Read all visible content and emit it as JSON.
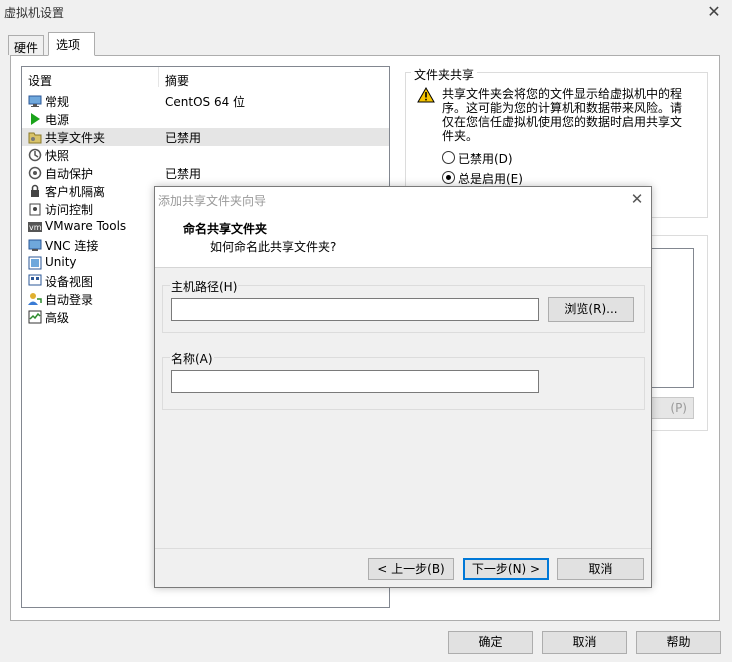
{
  "window": {
    "title": "虚拟机设置"
  },
  "tabs": [
    {
      "label": "硬件"
    },
    {
      "label": "选项"
    }
  ],
  "list": {
    "headers": {
      "setting": "设置",
      "summary": "摘要"
    },
    "rows": [
      {
        "label": "常规",
        "summary": "CentOS 64 位",
        "icon": "monitor-icon",
        "color": "#3a7bd5"
      },
      {
        "label": "电源",
        "summary": "",
        "icon": "play-icon",
        "color": "#1aa31a"
      },
      {
        "label": "共享文件夹",
        "summary": "已禁用",
        "icon": "shared-folder-icon",
        "color": "#8b8b3a"
      },
      {
        "label": "快照",
        "summary": "",
        "icon": "snapshot-icon",
        "color": "#555555"
      },
      {
        "label": "自动保护",
        "summary": "已禁用",
        "icon": "autoprotect-icon",
        "color": "#555555"
      },
      {
        "label": "客户机隔离",
        "summary": "",
        "icon": "lock-icon",
        "color": "#444444"
      },
      {
        "label": "访问控制",
        "summary": "",
        "icon": "access-control-icon",
        "color": "#444444"
      },
      {
        "label": "VMware Tools",
        "summary": "",
        "icon": "vm-icon",
        "color": "#555555"
      },
      {
        "label": "VNC 连接",
        "summary": "",
        "icon": "vnc-icon",
        "color": "#3a7bd5"
      },
      {
        "label": "Unity",
        "summary": "",
        "icon": "unity-icon",
        "color": "#3a7bd5"
      },
      {
        "label": "设备视图",
        "summary": "",
        "icon": "device-view-icon",
        "color": "#3a7bd5"
      },
      {
        "label": "自动登录",
        "summary": "",
        "icon": "autologin-icon",
        "color": "#d9a400"
      },
      {
        "label": "高级",
        "summary": "",
        "icon": "advanced-icon",
        "color": "#2e8b2e"
      }
    ],
    "selected_index": 2
  },
  "folder_sharing": {
    "title": "文件夹共享",
    "warning": "共享文件夹会将您的文件显示给虚拟机中的程序。这可能为您的计算机和数据带来风险。请仅在您信任虚拟机使用您的数据时启用共享文件夹。",
    "options": [
      {
        "label": "已禁用(D)",
        "checked": false
      },
      {
        "label": "总是启用(E)",
        "checked": true
      }
    ],
    "properties_fragment": "(P)"
  },
  "buttons": {
    "ok": "确定",
    "cancel": "取消",
    "help": "帮助"
  },
  "wizard": {
    "title": "添加共享文件夹向导",
    "heading": "命名共享文件夹",
    "subheading": "如何命名此共享文件夹?",
    "host_path_label": "主机路径(H)",
    "host_path_value": "",
    "browse_label": "浏览(R)...",
    "name_label": "名称(A)",
    "name_value": "",
    "back_label": "< 上一步(B)",
    "next_label": "下一步(N) >",
    "cancel_label": "取消"
  }
}
